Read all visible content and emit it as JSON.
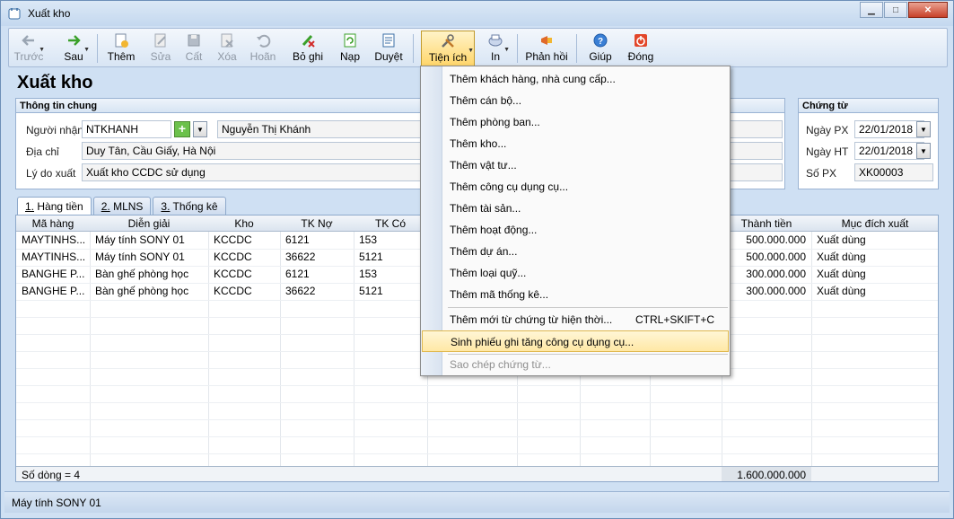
{
  "window": {
    "title": "Xuất kho",
    "minimize_glyph": "▁",
    "maximize_glyph": "□",
    "close_glyph": "✕"
  },
  "toolbar": {
    "items": [
      {
        "label": "Trước",
        "icon": "arrow-left-icon",
        "enabled": false
      },
      {
        "label": "Sau",
        "icon": "arrow-right-icon",
        "enabled": true
      },
      {
        "label": "Thêm",
        "icon": "add-doc-icon",
        "enabled": true
      },
      {
        "label": "Sửa",
        "icon": "edit-doc-icon",
        "enabled": false
      },
      {
        "label": "Cất",
        "icon": "save-icon",
        "enabled": false
      },
      {
        "label": "Xóa",
        "icon": "delete-icon",
        "enabled": false
      },
      {
        "label": "Hoãn",
        "icon": "undo-icon",
        "enabled": false
      },
      {
        "label": "Bỏ ghi",
        "icon": "unpost-icon",
        "enabled": true
      },
      {
        "label": "Nạp",
        "icon": "refresh-icon",
        "enabled": true
      },
      {
        "label": "Duyệt",
        "icon": "approve-icon",
        "enabled": true
      },
      {
        "label": "Tiện ích",
        "icon": "tools-icon",
        "enabled": true,
        "active": true
      },
      {
        "label": "In",
        "icon": "print-icon",
        "enabled": true
      },
      {
        "label": "Phản hồi",
        "icon": "feedback-icon",
        "enabled": true
      },
      {
        "label": "Giúp",
        "icon": "help-icon",
        "enabled": true
      },
      {
        "label": "Đóng",
        "icon": "close-power-icon",
        "enabled": true
      }
    ]
  },
  "page_title": "Xuất kho",
  "general_info": {
    "header": "Thông tin chung",
    "recipient_label": "Người nhận",
    "recipient_code": "NTKHANH",
    "recipient_name": "Nguyễn Thị Khánh",
    "address_label": "Địa chỉ",
    "address": "Duy Tân, Cầu Giấy, Hà Nội",
    "reason_label": "Lý do xuất",
    "reason": "Xuất kho CCDC sử dụng"
  },
  "voucher": {
    "header": "Chứng từ",
    "date_px_label": "Ngày PX",
    "date_px": "22/01/2018",
    "date_ht_label": "Ngày HT",
    "date_ht": "22/01/2018",
    "number_label": "Số PX",
    "number": "XK00003"
  },
  "tabs": [
    {
      "key": "1.",
      "label": " Hàng tiền"
    },
    {
      "key": "2.",
      "label": " MLNS"
    },
    {
      "key": "3.",
      "label": " Thống kê"
    }
  ],
  "grid": {
    "columns": [
      "Mã hàng",
      "Diễn giải",
      "Kho",
      "TK Nợ",
      "TK Có",
      "Thành tiền",
      "Mục đích xuất"
    ],
    "rows": [
      [
        "MAYTINHS...",
        "Máy tính SONY 01",
        "KCCDC",
        "6121",
        "153",
        "500.000.000",
        "Xuất dùng"
      ],
      [
        "MAYTINHS...",
        "Máy tính SONY 01",
        "KCCDC",
        "36622",
        "5121",
        "500.000.000",
        "Xuất dùng"
      ],
      [
        "BANGHE P...",
        "Bàn ghế phòng học",
        "KCCDC",
        "6121",
        "153",
        "300.000.000",
        "Xuất dùng"
      ],
      [
        "BANGHE P...",
        "Bàn ghế phòng học",
        "KCCDC",
        "36622",
        "5121",
        "300.000.000",
        "Xuất dùng"
      ]
    ],
    "footer_count": "Số dòng = 4",
    "footer_total": "1.600.000.000"
  },
  "status": "Máy tính SONY 01",
  "menu": {
    "items": [
      {
        "label": "Thêm khách hàng, nhà cung cấp..."
      },
      {
        "label": "Thêm cán bộ..."
      },
      {
        "label": "Thêm phòng ban..."
      },
      {
        "label": "Thêm kho..."
      },
      {
        "label": "Thêm vật tư..."
      },
      {
        "label": "Thêm công cụ dụng cụ..."
      },
      {
        "label": "Thêm tài sản..."
      },
      {
        "label": "Thêm hoạt động..."
      },
      {
        "label": "Thêm dự án..."
      },
      {
        "label": "Thêm loại quỹ..."
      },
      {
        "label": "Thêm mã thống kê..."
      },
      {
        "label": "Thêm mới từ chứng từ hiện thời...",
        "shortcut": "CTRL+SKIFT+C"
      },
      {
        "label": "Sinh phiếu ghi tăng công cụ dụng cụ...",
        "highlighted": true
      },
      {
        "label": "Sao chép chứng từ...",
        "enabled": false
      }
    ]
  }
}
